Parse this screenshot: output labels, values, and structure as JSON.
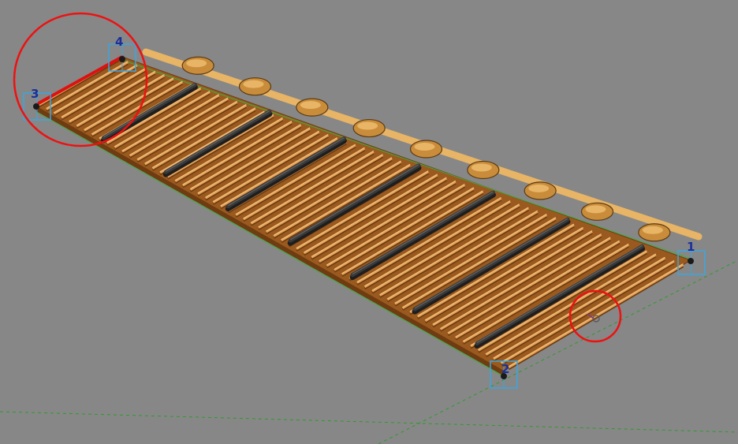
{
  "viewport": {
    "background": "#878787"
  },
  "model": {
    "element": "roof-framing-assembly",
    "colors": {
      "deck": "#9a5a1f",
      "deck_dark": "#6e3c10",
      "batten": "#e4a35a",
      "batten_light": "#f3c684",
      "purlin": "#3a3a3a",
      "purlin_top": "#6a6a6a",
      "ridge": "#e8b466",
      "edge_line": "#3fae3f",
      "selection_line": "#dd1111",
      "highlight_circle": "#ee1111",
      "grip": "#3aa6e0",
      "grip_label": "#1b2f9a",
      "axis_dash": "#2e9a2e"
    }
  },
  "grips": [
    {
      "label": "1"
    },
    {
      "label": "2"
    },
    {
      "label": "3"
    },
    {
      "label": "4"
    }
  ],
  "annotations": {
    "circles": [
      "highlight-circle-top-left",
      "highlight-circle-lower-right"
    ]
  }
}
